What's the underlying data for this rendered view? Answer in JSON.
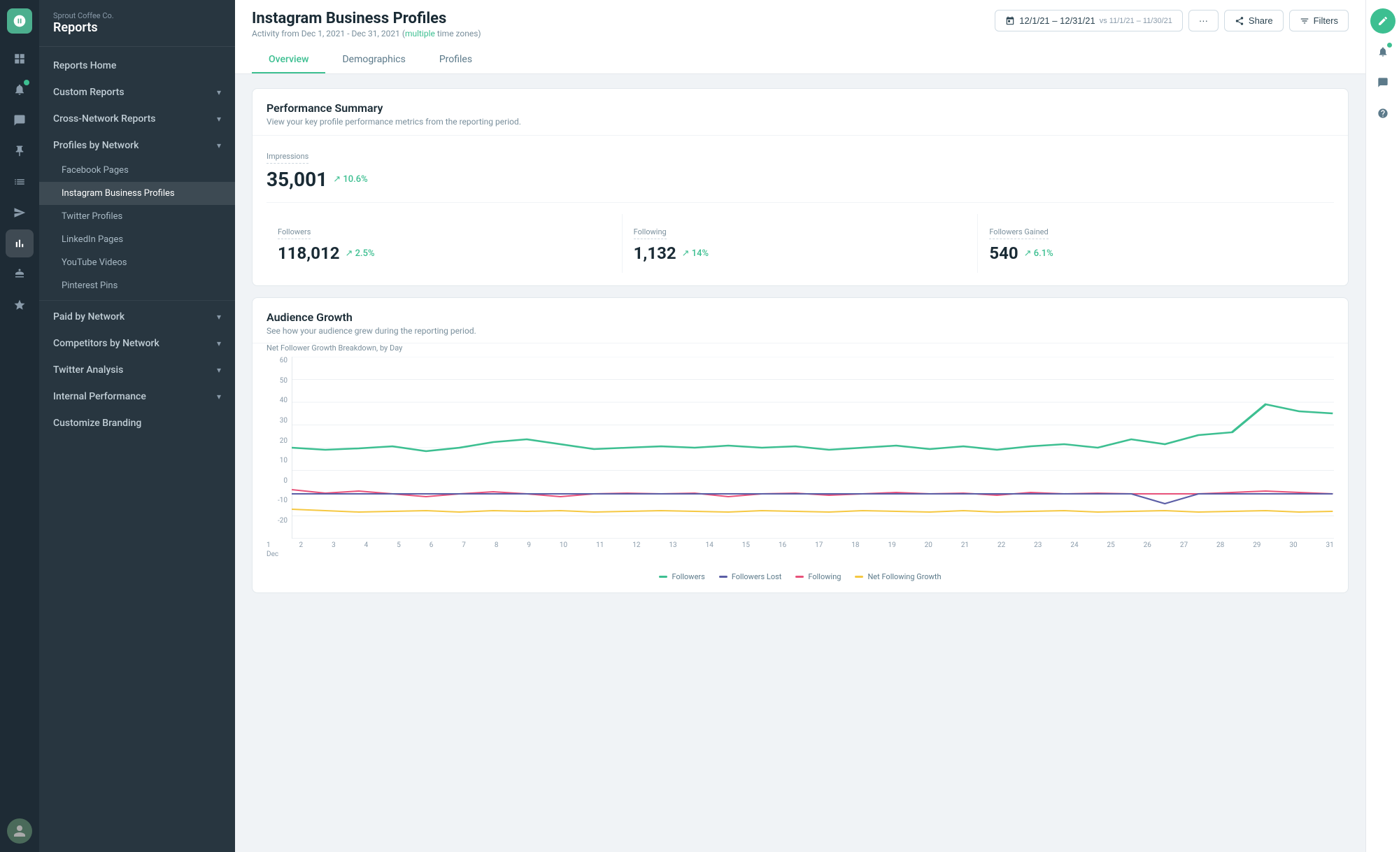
{
  "app": {
    "company": "Sprout Coffee Co.",
    "section": "Reports"
  },
  "sidebar": {
    "items": [
      {
        "id": "reports-home",
        "label": "Reports Home",
        "level": 0,
        "hasChevron": false
      },
      {
        "id": "custom-reports",
        "label": "Custom Reports",
        "level": 0,
        "hasChevron": true
      },
      {
        "id": "cross-network",
        "label": "Cross-Network Reports",
        "level": 0,
        "hasChevron": true
      },
      {
        "id": "profiles-by-network",
        "label": "Profiles by Network",
        "level": 0,
        "hasChevron": true
      },
      {
        "id": "facebook-pages",
        "label": "Facebook Pages",
        "level": 1
      },
      {
        "id": "instagram-business",
        "label": "Instagram Business Profiles",
        "level": 1,
        "active": true
      },
      {
        "id": "twitter-profiles",
        "label": "Twitter Profiles",
        "level": 1
      },
      {
        "id": "linkedin-pages",
        "label": "LinkedIn Pages",
        "level": 1
      },
      {
        "id": "youtube-videos",
        "label": "YouTube Videos",
        "level": 1
      },
      {
        "id": "pinterest-pins",
        "label": "Pinterest Pins",
        "level": 1
      },
      {
        "id": "paid-by-network",
        "label": "Paid by Network",
        "level": 0,
        "hasChevron": true
      },
      {
        "id": "competitors-by-network",
        "label": "Competitors by Network",
        "level": 0,
        "hasChevron": true
      },
      {
        "id": "twitter-analysis",
        "label": "Twitter Analysis",
        "level": 0,
        "hasChevron": true
      },
      {
        "id": "internal-performance",
        "label": "Internal Performance",
        "level": 0,
        "hasChevron": true
      },
      {
        "id": "customize-branding",
        "label": "Customize Branding",
        "level": 0
      }
    ]
  },
  "header": {
    "title": "Instagram Business Profiles",
    "subtitle": "Activity from Dec 1, 2021 - Dec 31, 2021",
    "timezones": "multiple",
    "dateRange": "12/1/21 – 12/31/21",
    "compareRange": "vs 11/1/21 – 11/30/21",
    "shareLabel": "Share",
    "filtersLabel": "Filters"
  },
  "tabs": [
    {
      "id": "overview",
      "label": "Overview",
      "active": true
    },
    {
      "id": "demographics",
      "label": "Demographics"
    },
    {
      "id": "profiles",
      "label": "Profiles"
    }
  ],
  "performanceSummary": {
    "title": "Performance Summary",
    "desc": "View your key profile performance metrics from the reporting period.",
    "metrics": {
      "impressions": {
        "label": "Impressions",
        "value": "35,001",
        "change": "10.6%"
      },
      "followers": {
        "label": "Followers",
        "value": "118,012",
        "change": "2.5%"
      },
      "following": {
        "label": "Following",
        "value": "1,132",
        "change": "14%"
      },
      "followersGained": {
        "label": "Followers Gained",
        "value": "540",
        "change": "6.1%"
      }
    }
  },
  "audienceGrowth": {
    "title": "Audience Growth",
    "desc": "See how your audience grew during the reporting period.",
    "chartLabel": "Net Follower Growth Breakdown, by Day",
    "yAxis": [
      "60",
      "50",
      "40",
      "30",
      "20",
      "10",
      "0",
      "-10",
      "-20"
    ],
    "xAxis": [
      "1",
      "2",
      "3",
      "4",
      "5",
      "6",
      "7",
      "8",
      "9",
      "10",
      "11",
      "12",
      "13",
      "14",
      "15",
      "16",
      "17",
      "18",
      "19",
      "20",
      "21",
      "22",
      "23",
      "24",
      "25",
      "26",
      "27",
      "28",
      "29",
      "30",
      "31"
    ],
    "xSubLabel": "Dec",
    "legend": [
      {
        "id": "followers",
        "label": "Followers",
        "color": "#3dbf91"
      },
      {
        "id": "followers-lost",
        "label": "Followers Lost",
        "color": "#5b5ea6"
      },
      {
        "id": "following",
        "label": "Following",
        "color": "#e8527a"
      },
      {
        "id": "net-following",
        "label": "Net Following Growth",
        "color": "#f5c842"
      }
    ]
  },
  "colors": {
    "accent": "#3dbf91",
    "sidebar": "#283640",
    "active": "#3dbf91",
    "text": "#1a2b35"
  }
}
